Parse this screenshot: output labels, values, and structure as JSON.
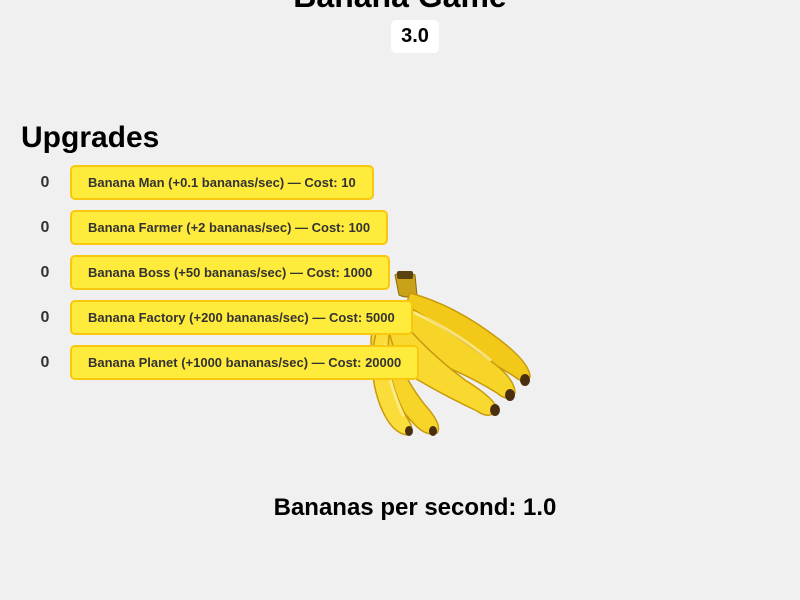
{
  "game": {
    "title": "Banana Game",
    "banana_count": "3.0"
  },
  "upgrades": {
    "heading": "Upgrades",
    "items": [
      {
        "count": "0",
        "label": "Banana Man (+0.1 bananas/sec) — Cost: 10"
      },
      {
        "count": "0",
        "label": "Banana Farmer (+2 bananas/sec) — Cost: 100"
      },
      {
        "count": "0",
        "label": "Banana Boss (+50 bananas/sec) — Cost: 1000"
      },
      {
        "count": "0",
        "label": "Banana Factory (+200 bananas/sec) — Cost: 5000"
      },
      {
        "count": "0",
        "label": "Banana Planet (+1000 bananas/sec) — Cost: 20000"
      }
    ]
  },
  "stats": {
    "bananas_per_second": "Bananas per second: 1.0"
  },
  "icons": {
    "banana_image": "banana-bunch-icon"
  },
  "colors": {
    "background": "#f0f0f0",
    "button_fill": "#ffeb3b",
    "button_border": "#f9c80e",
    "banana_yellow": "#f7d528",
    "banana_shadow": "#d9a713"
  }
}
